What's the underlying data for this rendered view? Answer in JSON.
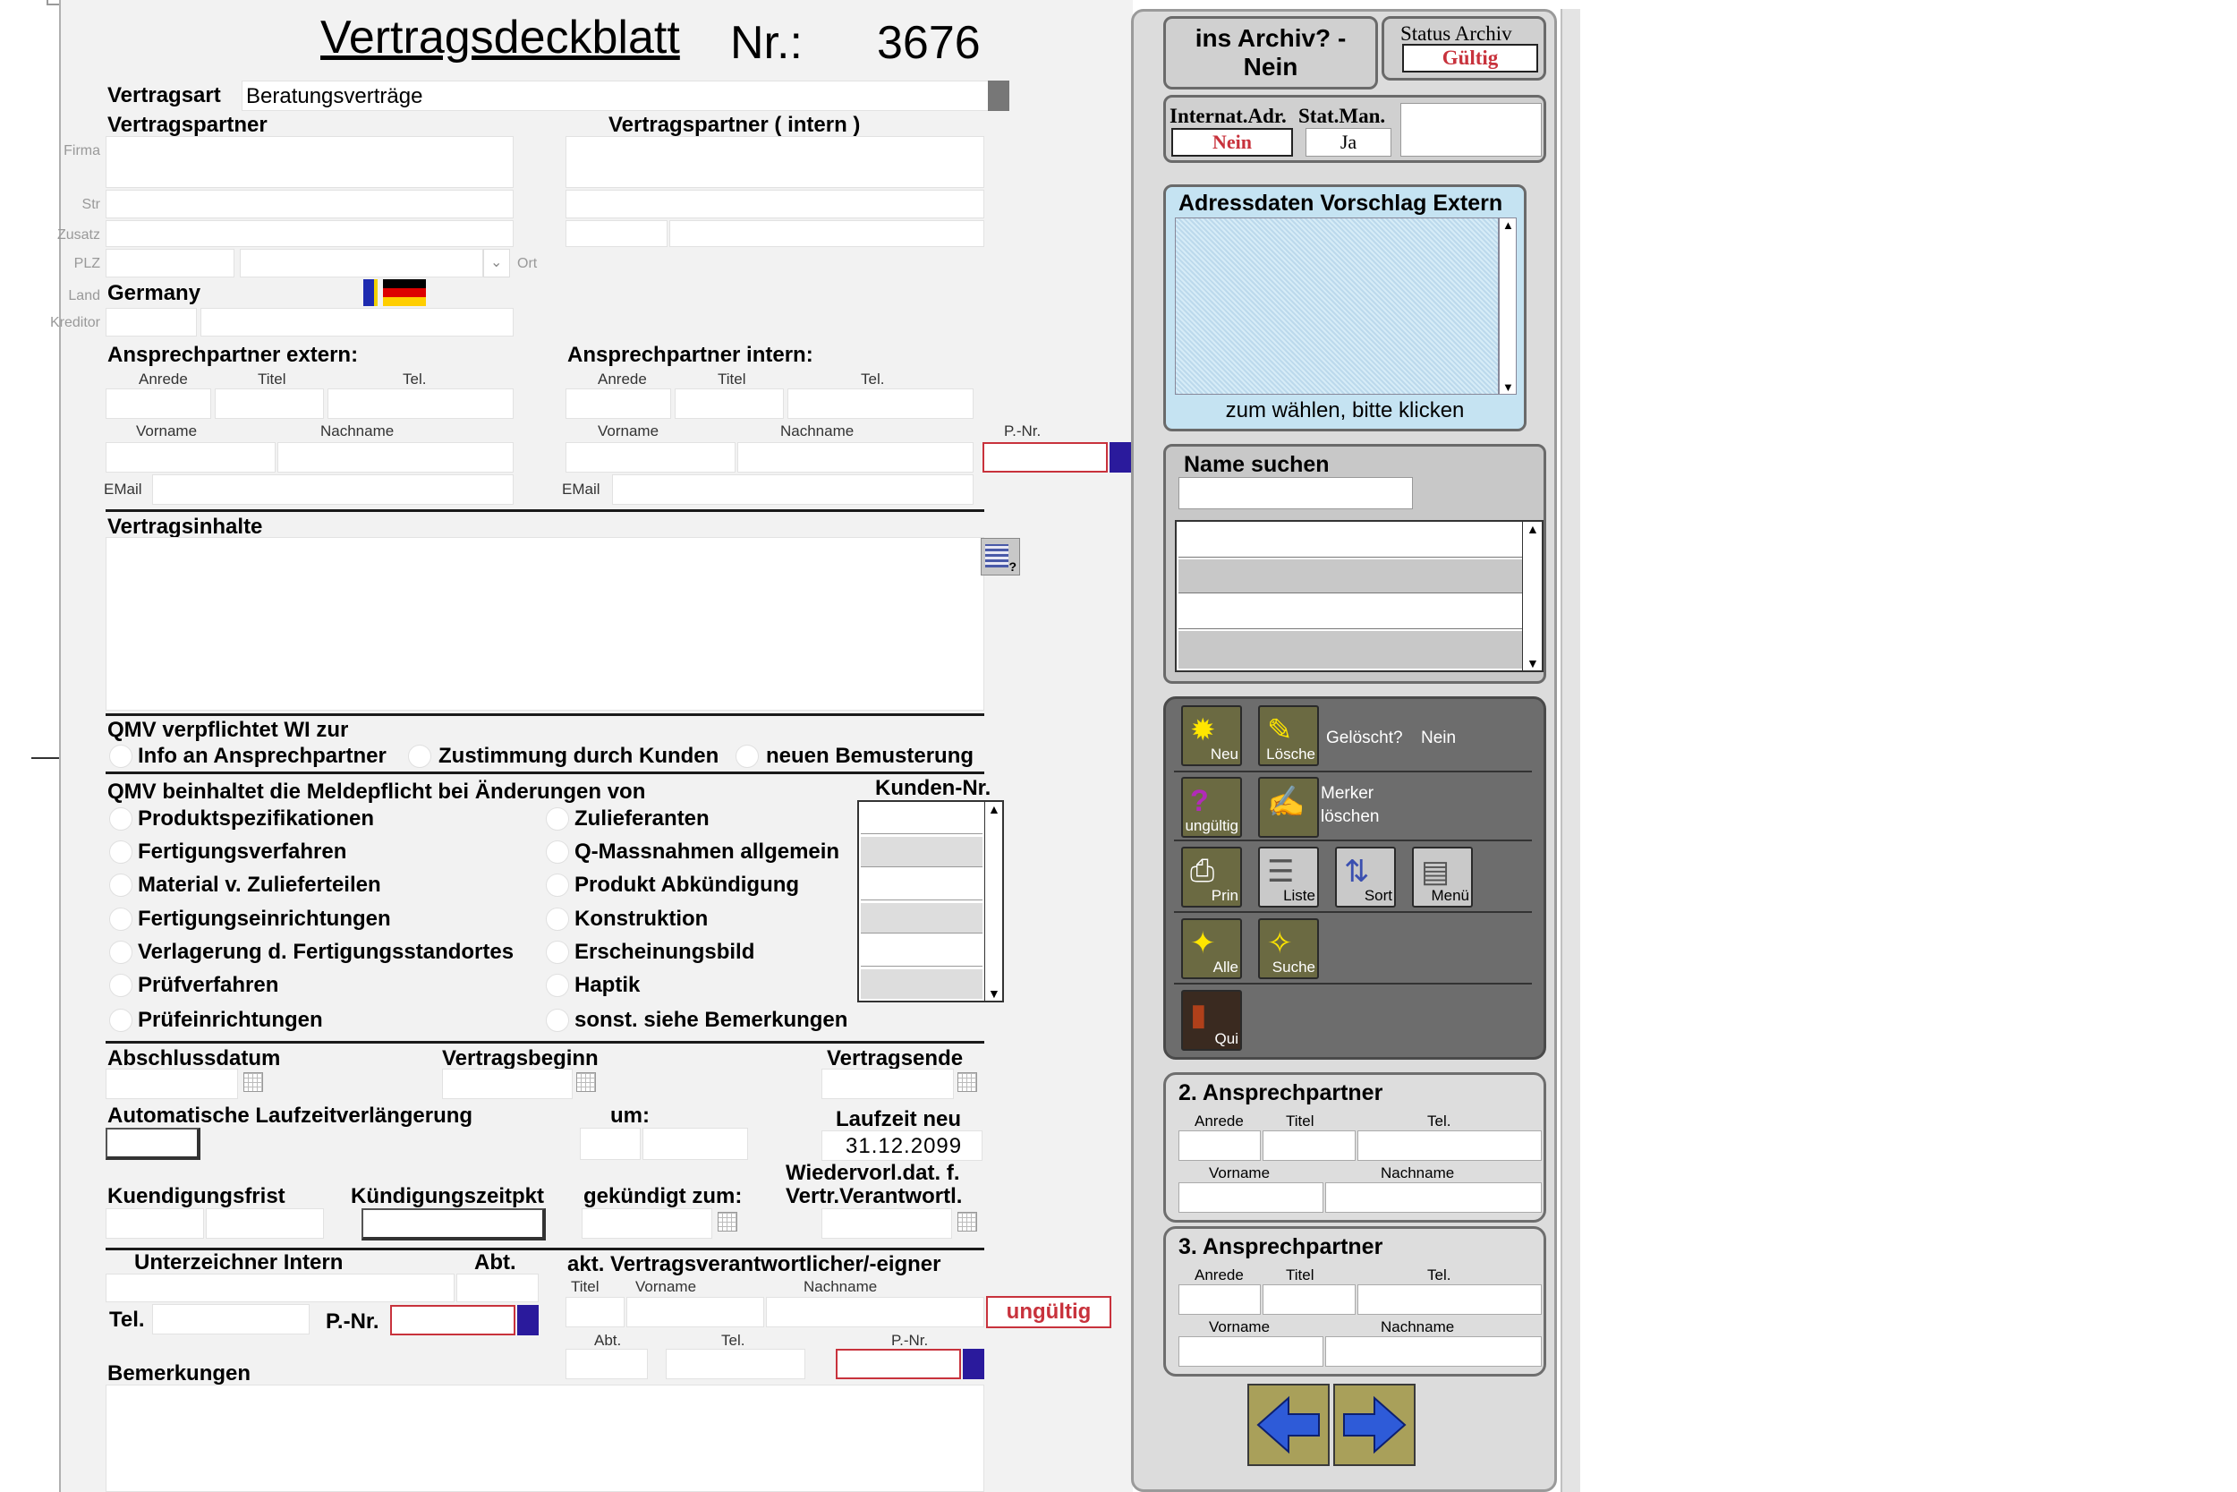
{
  "header": {
    "title": "Vertragsdeckblatt",
    "nr_label": "Nr.:",
    "nr_value": "3676"
  },
  "vertragsart": {
    "label": "Vertragsart",
    "value": "Beratungsverträge"
  },
  "partner": {
    "extern_label": "Vertragspartner",
    "intern_label": "Vertragspartner ( intern )",
    "firma_label": "Firma",
    "str_label": "Str",
    "zusatz_label": "Zusatz",
    "plz_label": "PLZ",
    "ort_label": "Ort",
    "land_label": "Land",
    "land_value": "Germany",
    "kreditor_label": "Kreditor"
  },
  "ansprech_extern": {
    "title": "Ansprechpartner extern:",
    "anrede": "Anrede",
    "titel": "Titel",
    "tel": "Tel.",
    "vorname": "Vorname",
    "nachname": "Nachname",
    "email": "EMail"
  },
  "ansprech_intern": {
    "title": "Ansprechpartner intern:",
    "anrede": "Anrede",
    "titel": "Titel",
    "tel": "Tel.",
    "vorname": "Vorname",
    "nachname": "Nachname",
    "email": "EMail",
    "pnr": "P.-Nr."
  },
  "vertragsinhalte": {
    "label": "Vertragsinhalte"
  },
  "qmv_wi": {
    "title": "QMV verpflichtet WI zur",
    "options": [
      "Info an Ansprechpartner",
      "Zustimmung durch Kunden",
      "neuen Bemusterung"
    ]
  },
  "qmv_meld": {
    "title": "QMV beinhaltet die Meldepflicht bei Änderungen von",
    "left": [
      "Produktspezifikationen",
      "Fertigungsverfahren",
      "Material v. Zulieferteilen",
      "Fertigungseinrichtungen",
      "Verlagerung d. Fertigungsstandortes",
      "Prüfverfahren",
      "Prüfeinrichtungen"
    ],
    "right": [
      "Zulieferanten",
      "Q-Massnahmen allgemein",
      "Produkt Abkündigung",
      "Konstruktion",
      "Erscheinungsbild",
      "Haptik",
      "sonst. siehe Bemerkungen"
    ],
    "kunden_nr": "Kunden-Nr."
  },
  "dates": {
    "abschluss": "Abschlussdatum",
    "beginn": "Vertragsbeginn",
    "ende": "Vertragsende",
    "auto": "Automatische Laufzeitverlängerung",
    "um": "um:",
    "laufzeit_neu": "Laufzeit neu",
    "laufzeit_value": "31.12.2099",
    "kuend_frist": "Kuendigungsfrist",
    "kuend_zeitpkt": "Kündigungszeitpkt",
    "gekuendigt": "gekündigt zum:",
    "wiedervorl1": "Wiedervorl.dat. f.",
    "wiedervorl2": "Vertr.Verantwortl."
  },
  "unterzeichner": {
    "title": "Unterzeichner Intern",
    "abt": "Abt.",
    "tel": "Tel.",
    "pnr": "P.-Nr."
  },
  "verantwortlicher": {
    "title": "akt. Vertragsverantwortlicher/-eigner",
    "titel": "Titel",
    "vorname": "Vorname",
    "nachname": "Nachname",
    "status": "ungültig",
    "abt": "Abt.",
    "tel": "Tel.",
    "pnr": "P.-Nr."
  },
  "bemerkungen": {
    "label": "Bemerkungen"
  },
  "side": {
    "archiv_btn_line1": "ins Archiv? -",
    "archiv_btn_line2": "Nein",
    "status_archiv_label": "Status Archiv",
    "status_archiv_value": "Gültig",
    "internat_label": "Internat.Adr.",
    "internat_value": "Nein",
    "statman_label": "Stat.Man.",
    "statman_value": "Ja",
    "adress_title": "Adressdaten Vorschlag Extern",
    "adress_hint": "zum wählen, bitte klicken",
    "name_suchen": "Name suchen"
  },
  "toolbar": {
    "neu": "Neu",
    "loeschen": "Lösche",
    "geloescht_label": "Gelöscht?",
    "geloescht_value": "Nein",
    "ungueltig": "ungültig",
    "merker1": "Merker",
    "merker2": "löschen",
    "print": "Prin",
    "liste": "Liste",
    "sort": "Sort",
    "menu": "Menü",
    "alle": "Alle",
    "suche": "Suche",
    "quit": "Qui"
  },
  "ansprech2": {
    "title": "2. Ansprechpartner",
    "anrede": "Anrede",
    "titel": "Titel",
    "tel": "Tel.",
    "vorname": "Vorname",
    "nachname": "Nachname"
  },
  "ansprech3": {
    "title": "3. Ansprechpartner",
    "anrede": "Anrede",
    "titel": "Titel",
    "tel": "Tel.",
    "vorname": "Vorname",
    "nachname": "Nachname"
  },
  "colors": {
    "accent_red": "#c8323c",
    "pnr_blue": "#2a1a9c",
    "panel_gray": "#dddddd"
  }
}
